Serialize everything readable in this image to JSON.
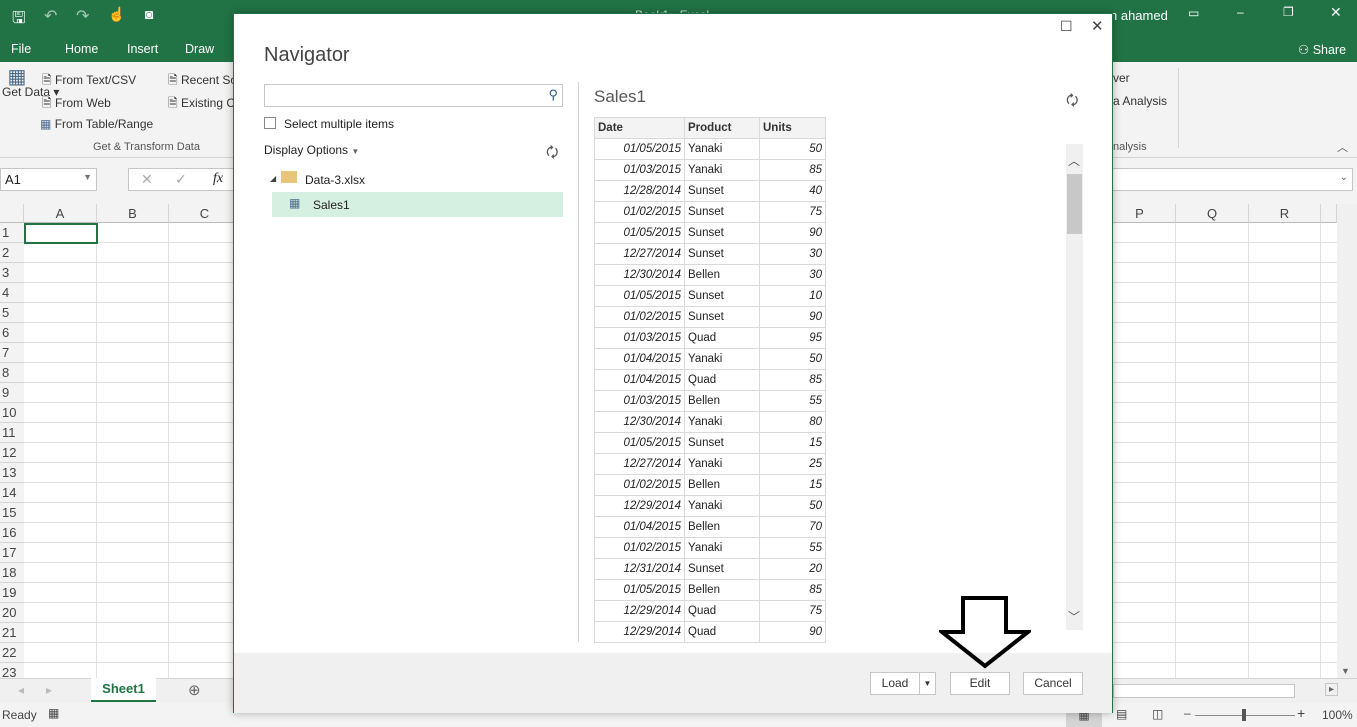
{
  "window": {
    "title": "Book1 - Excel",
    "user": "n ahamed",
    "share": "Share"
  },
  "ribbon_tabs": [
    "File",
    "Home",
    "Insert",
    "Draw"
  ],
  "ribbon": {
    "get_data": "Get Data",
    "from_text_csv": "From Text/CSV",
    "from_web": "From Web",
    "from_table_range": "From Table/Range",
    "recent_sources": "Recent So",
    "existing_connections": "Existing C",
    "group_label": "Get & Transform Data",
    "right_item1": "ver",
    "right_item2": "a Analysis",
    "right_group": "nalysis"
  },
  "formula_bar": {
    "name_box": "A1",
    "fx": "fx"
  },
  "columns_left": [
    "A",
    "B",
    "C"
  ],
  "columns_right": [
    "P",
    "Q",
    "R"
  ],
  "rows": [
    "1",
    "2",
    "3",
    "4",
    "5",
    "6",
    "7",
    "8",
    "9",
    "10",
    "11",
    "12",
    "13",
    "14",
    "15",
    "16",
    "17",
    "18",
    "19",
    "20",
    "21",
    "22",
    "23"
  ],
  "sheet_tab": "Sheet1",
  "status": {
    "ready": "Ready",
    "zoom": "100%"
  },
  "navigator": {
    "title": "Navigator",
    "search_placeholder": "",
    "select_multiple": "Select multiple items",
    "display_options": "Display Options",
    "tree": {
      "file": "Data-3.xlsx",
      "item": "Sales1"
    },
    "preview_title": "Sales1",
    "headers": [
      "Date",
      "Product",
      "Units"
    ],
    "rows": [
      [
        "01/05/2015",
        "Yanaki",
        "50"
      ],
      [
        "01/03/2015",
        "Yanaki",
        "85"
      ],
      [
        "12/28/2014",
        "Sunset",
        "40"
      ],
      [
        "01/02/2015",
        "Sunset",
        "75"
      ],
      [
        "01/05/2015",
        "Sunset",
        "90"
      ],
      [
        "12/27/2014",
        "Sunset",
        "30"
      ],
      [
        "12/30/2014",
        "Bellen",
        "30"
      ],
      [
        "01/05/2015",
        "Sunset",
        "10"
      ],
      [
        "01/02/2015",
        "Sunset",
        "90"
      ],
      [
        "01/03/2015",
        "Quad",
        "95"
      ],
      [
        "01/04/2015",
        "Yanaki",
        "50"
      ],
      [
        "01/04/2015",
        "Quad",
        "85"
      ],
      [
        "01/03/2015",
        "Bellen",
        "55"
      ],
      [
        "12/30/2014",
        "Yanaki",
        "80"
      ],
      [
        "01/05/2015",
        "Sunset",
        "15"
      ],
      [
        "12/27/2014",
        "Yanaki",
        "25"
      ],
      [
        "01/02/2015",
        "Bellen",
        "15"
      ],
      [
        "12/29/2014",
        "Yanaki",
        "50"
      ],
      [
        "01/04/2015",
        "Bellen",
        "70"
      ],
      [
        "01/02/2015",
        "Yanaki",
        "55"
      ],
      [
        "12/31/2014",
        "Sunset",
        "20"
      ],
      [
        "01/05/2015",
        "Bellen",
        "85"
      ],
      [
        "12/29/2014",
        "Quad",
        "75"
      ],
      [
        "12/29/2014",
        "Quad",
        "90"
      ]
    ],
    "buttons": {
      "load": "Load",
      "edit": "Edit",
      "cancel": "Cancel"
    }
  },
  "colors": {
    "excel_green": "#217346",
    "selected_item": "#d5efe1"
  }
}
